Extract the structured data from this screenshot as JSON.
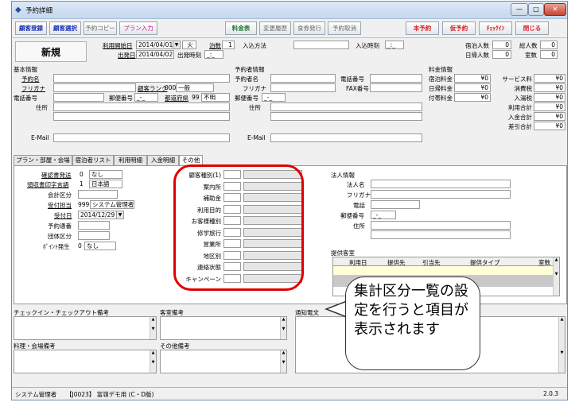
{
  "window": {
    "title": "予約詳細",
    "min": "—",
    "max": "□",
    "close": "✕"
  },
  "toolbar": {
    "guest_register": "顧客登録",
    "guest_select": "顧客選択",
    "copy": "予約コピー",
    "plan_input": "プラン入力",
    "rate_table": "料金表",
    "history": "変更履歴",
    "meal_ticket": "食券発行",
    "cancel": "予約取消",
    "confirm": "本予約",
    "tentative": "仮予約",
    "checkin": "ﾁｪｯｸｲﾝ",
    "close": "閉じる"
  },
  "header": {
    "status": "新規",
    "usage_start_label": "利用開始日",
    "usage_start": "2014/04/01",
    "weekday": "火",
    "nights_label": "泊数",
    "nights": "1",
    "arrival_method_label": "入込方法",
    "arrival_time_label": "入込時刻",
    "arrival_time": "_:_",
    "departure_label": "出発日",
    "departure": "2014/04/02",
    "departure_time_label": "出発時刻",
    "departure_time": "_:_",
    "stay_count_label": "宿泊人数",
    "stay_count": "0",
    "total_count_label": "総人数",
    "total_count": "0",
    "day_count_label": "日帰人数",
    "day_count": "0",
    "room_count_label": "室数",
    "room_count": "0"
  },
  "basic": {
    "section": "基本情報",
    "name_label": "予約名",
    "kana_label": "フリガナ",
    "rank_label": "顧客ランク",
    "rank_code": "000",
    "rank": "一般",
    "phone_label": "電話番号",
    "zip_label": "郵便番号",
    "zip": "_-_",
    "pref_label": "都道府県",
    "pref_code": "99",
    "pref": "不明",
    "address_label": "住所",
    "email_label": "E-Mail"
  },
  "booker": {
    "section": "予約者情報",
    "name_label": "予約者名",
    "phone_label": "電話番号",
    "kana_label": "フリガナ",
    "fax_label": "FAX番号",
    "zip_label": "郵便番号",
    "zip": "_-_",
    "address_label": "住所",
    "email_label": "E-Mail"
  },
  "fees": {
    "section": "料金情報",
    "rows": [
      {
        "label": "宿泊料金",
        "value": "¥0",
        "label2": "サービス料",
        "value2": "¥0"
      },
      {
        "label": "日帰料金",
        "value": "¥0",
        "label2": "消費税",
        "value2": "¥0"
      },
      {
        "label": "付帯料金",
        "value": "¥0",
        "label2": "入湯税",
        "value2": "¥0"
      },
      {
        "label": "",
        "value": "",
        "label2": "利用合計",
        "value2": "¥0"
      },
      {
        "label": "",
        "value": "",
        "label2": "入金合計",
        "value2": "¥0"
      },
      {
        "label": "",
        "value": "",
        "label2": "差引合計",
        "value2": "¥0"
      }
    ]
  },
  "tabs": [
    "プラン・部屋・会場",
    "宿泊者リスト",
    "利用明細",
    "入金明細",
    "その他"
  ],
  "other": {
    "confirm_send_label": "確認書発送",
    "confirm_send_code": "0",
    "confirm_send": "なし",
    "receipt_lang_label": "領収書印字言語",
    "receipt_lang_code": "1",
    "receipt_lang": "日本語",
    "account_label": "会計区分",
    "staff_label": "受付担当",
    "staff_code": "999",
    "staff": "システム管理者",
    "reception_date_label": "受付日",
    "reception_date": "2014/12/29",
    "channel_label": "予約通番",
    "group_label": "団体区分",
    "points_label": "ﾎﾟｲﾝﾄ発生",
    "points_code": "0",
    "points": "なし"
  },
  "categories": {
    "items": [
      "顧客種別(1)",
      "案内所",
      "補助金",
      "利用目的",
      "お客様種別",
      "修学旅行",
      "営業所",
      "地区別",
      "連絡状態",
      "キャンペーン"
    ]
  },
  "corp": {
    "section": "法人情報",
    "name_label": "法人名",
    "kana_label": "フリガナ",
    "phone_label": "電話",
    "zip_label": "郵便番号",
    "zip": "_-_",
    "address_label": "住所"
  },
  "supply": {
    "section": "提供客室",
    "columns": [
      "利用日",
      "提供先",
      "引当先",
      "提供タイプ",
      "室数"
    ]
  },
  "memos": {
    "checkin_note": "チェックイン・チェックアウト備考",
    "room_note": "客室備考",
    "notice": "通知電文",
    "meal_note": "料理・会場備考",
    "other_note": "その他備考"
  },
  "status": {
    "user": "システム管理者",
    "company": "【J0023】 富嶺デモ用 (C・D版)",
    "version": "2.0.3"
  },
  "callout": {
    "text": "集計区分一覧の設定を行うと項目が表示されます"
  },
  "colors": {
    "accent": "#e00000",
    "link": "#1b2fb8"
  }
}
